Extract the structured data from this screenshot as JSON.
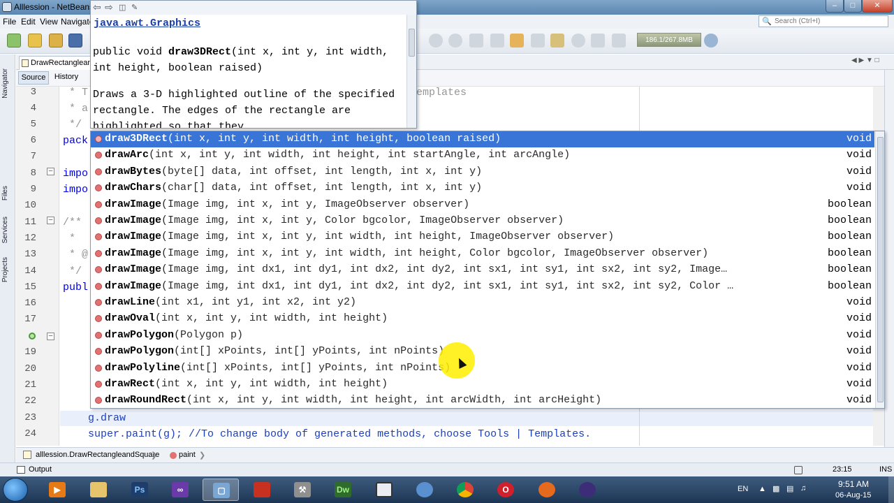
{
  "window": {
    "title": "Alllession - NetBeans"
  },
  "menu": {
    "items": [
      "File",
      "Edit",
      "View",
      "Navigate"
    ]
  },
  "search": {
    "placeholder": "Search (Ctrl+I)"
  },
  "memory": "186.1/267.8MB",
  "side_tabs": [
    "Navigator",
    "Files",
    "Services",
    "Projects"
  ],
  "editor": {
    "file_tab": "DrawRectangleandSquare.java",
    "source_label": "Source",
    "history_label": "History"
  },
  "gutter": {
    "line_numbers": [
      "3",
      "4",
      "5",
      "6",
      "7",
      "8",
      "9",
      "10",
      "11",
      "12",
      "13",
      "14",
      "15",
      "16",
      "17",
      "",
      "19",
      "20",
      "21",
      "22",
      "23",
      "24"
    ]
  },
  "code_lines": [
    {
      "line": "3",
      "text": " * T",
      "tail": "emplates"
    },
    {
      "line": "4",
      "text": " * a"
    },
    {
      "line": "5",
      "text": " */"
    },
    {
      "line": "6",
      "text": "pack"
    },
    {
      "line": "7",
      "text": ""
    },
    {
      "line": "8",
      "text": "impo"
    },
    {
      "line": "9",
      "text": "impo"
    },
    {
      "line": "10",
      "text": ""
    },
    {
      "line": "11",
      "text": "/**"
    },
    {
      "line": "12",
      "text": " *"
    },
    {
      "line": "13",
      "text": " * @"
    },
    {
      "line": "14",
      "text": " */"
    },
    {
      "line": "15",
      "text": "publ"
    },
    {
      "line": "23",
      "text": "    g.draw"
    },
    {
      "line": "24",
      "text": "    super.paint(g); //To change body of generated methods, choose Tools | Templates."
    }
  ],
  "javadoc": {
    "class_link": "java.awt.Graphics",
    "signature_prefix": "public void ",
    "signature_name": "draw3DRect",
    "signature_rest": "(int x, int y, int width, int height, boolean raised)",
    "description": "Draws a 3-D highlighted outline of the specified rectangle. The edges of the rectangle are highlighted so that they"
  },
  "completion": {
    "items": [
      {
        "name": "draw3DRect",
        "params": "(int x, int y, int width, int height, boolean raised)",
        "ret": "void",
        "selected": true
      },
      {
        "name": "drawArc",
        "params": "(int x, int y, int width, int height, int startAngle, int arcAngle)",
        "ret": "void"
      },
      {
        "name": "drawBytes",
        "params": "(byte[] data, int offset, int length, int x, int y)",
        "ret": "void"
      },
      {
        "name": "drawChars",
        "params": "(char[] data, int offset, int length, int x, int y)",
        "ret": "void"
      },
      {
        "name": "drawImage",
        "params": "(Image img, int x, int y, ImageObserver observer)",
        "ret": "boolean"
      },
      {
        "name": "drawImage",
        "params": "(Image img, int x, int y, Color bgcolor, ImageObserver observer)",
        "ret": "boolean"
      },
      {
        "name": "drawImage",
        "params": "(Image img, int x, int y, int width, int height, ImageObserver observer)",
        "ret": "boolean"
      },
      {
        "name": "drawImage",
        "params": "(Image img, int x, int y, int width, int height, Color bgcolor, ImageObserver observer)",
        "ret": "boolean"
      },
      {
        "name": "drawImage",
        "params": "(Image img, int dx1, int dy1, int dx2, int dy2, int sx1, int sy1, int sx2, int sy2, Image…",
        "ret": "boolean"
      },
      {
        "name": "drawImage",
        "params": "(Image img, int dx1, int dy1, int dx2, int dy2, int sx1, int sy1, int sx2, int sy2, Color …",
        "ret": "boolean"
      },
      {
        "name": "drawLine",
        "params": "(int x1, int y1, int x2, int y2)",
        "ret": "void"
      },
      {
        "name": "drawOval",
        "params": "(int x, int y, int width, int height)",
        "ret": "void"
      },
      {
        "name": "drawPolygon",
        "params": "(Polygon p)",
        "ret": "void"
      },
      {
        "name": "drawPolygon",
        "params": "(int[] xPoints, int[] yPoints, int nPoints)",
        "ret": "void"
      },
      {
        "name": "drawPolyline",
        "params": "(int[] xPoints, int[] yPoints, int nPoints)",
        "ret": "void"
      },
      {
        "name": "drawRect",
        "params": "(int x, int y, int width, int height)",
        "ret": "void"
      },
      {
        "name": "drawRoundRect",
        "params": "(int x, int y, int width, int height, int arcWidth, int arcHeight)",
        "ret": "void"
      }
    ]
  },
  "breadcrumb": {
    "class_label": "alllession.DrawRectangleandSquare",
    "method_label": "paint"
  },
  "output": {
    "label": "Output",
    "position": "23:15",
    "mode": "INS"
  },
  "taskbar": {
    "apps": [
      "Media Player",
      "File Explorer",
      "Photoshop",
      "Visual Studio",
      "NetBeans",
      "Java",
      "Tools",
      "Dreamweaver",
      "Window",
      "Network",
      "Chrome",
      "Opera",
      "Firefox",
      "Eclipse"
    ],
    "lang": "EN",
    "time": "9:51 AM",
    "date": "06-Aug-15"
  },
  "colors": {
    "selection": "#3875d7",
    "keyword": "#0000e6",
    "comment": "#969696",
    "method_dot": "#e27171"
  }
}
